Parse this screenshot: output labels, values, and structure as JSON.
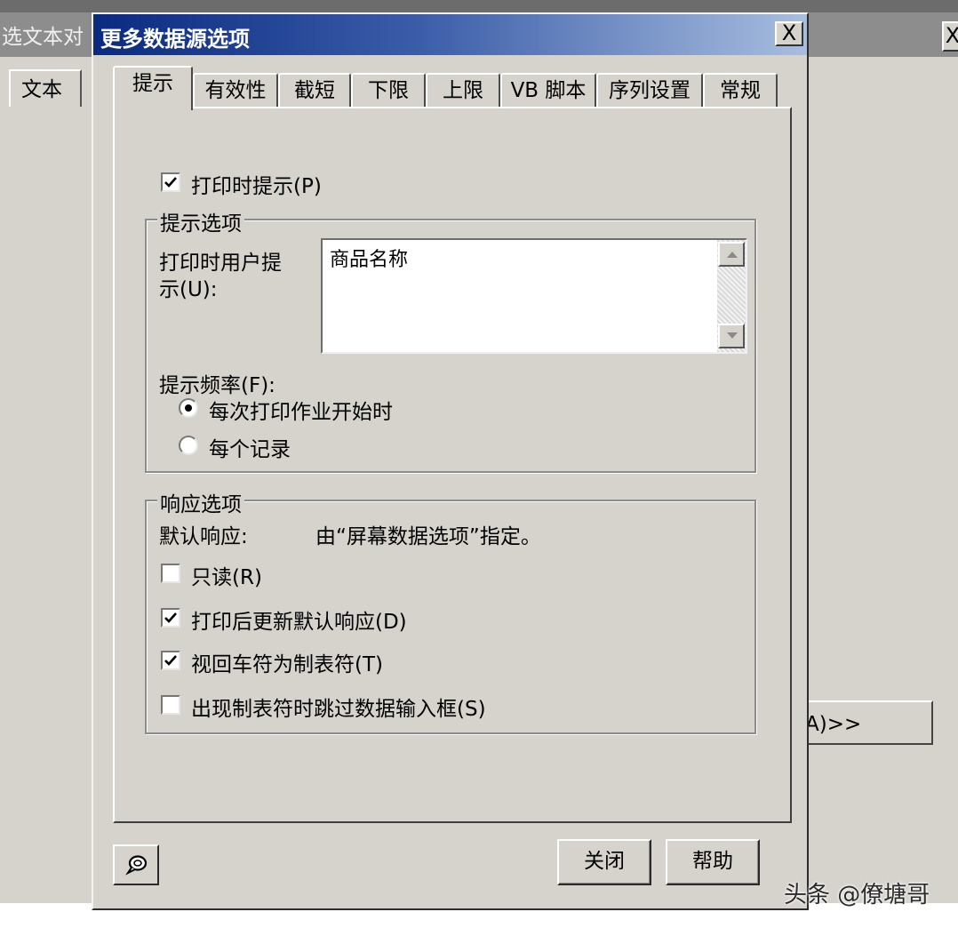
{
  "background_window": {
    "title": "选文本对",
    "close_label": "X",
    "tab_label": "文本",
    "button_label": "A)>>"
  },
  "dialog": {
    "title": "更多数据源选项",
    "close_label": "X",
    "tabs": [
      {
        "label": "提示",
        "active": true
      },
      {
        "label": "有效性",
        "active": false
      },
      {
        "label": "截短",
        "active": false
      },
      {
        "label": "下限",
        "active": false
      },
      {
        "label": "上限",
        "active": false
      },
      {
        "label": "VB 脚本",
        "active": false
      },
      {
        "label": "序列设置",
        "active": false
      },
      {
        "label": "常规",
        "active": false
      }
    ]
  },
  "prompt_tab": {
    "prompt_on_print": {
      "label": "打印时提示(P)",
      "checked": true
    },
    "prompt_options": {
      "title": "提示选项",
      "user_prompt_label_line1": "打印时用户提",
      "user_prompt_label_line2": "示(U):",
      "user_prompt_value": "商品名称",
      "frequency_label": "提示频率(F):",
      "frequency_options": [
        {
          "label": "每次打印作业开始时",
          "selected": true
        },
        {
          "label": "每个记录",
          "selected": false
        }
      ]
    },
    "response_options": {
      "title": "响应选项",
      "default_response_label": "默认响应:",
      "default_response_value": "由“屏幕数据选项”指定。",
      "checkboxes": [
        {
          "label": "只读(R)",
          "checked": false
        },
        {
          "label": "打印后更新默认响应(D)",
          "checked": true
        },
        {
          "label": "视回车符为制表符(T)",
          "checked": true
        },
        {
          "label": "出现制表符时跳过数据输入框(S)",
          "checked": false
        }
      ]
    }
  },
  "footer": {
    "close_button": "关闭",
    "help_button": "帮助",
    "help_icon": "help-bubble-icon"
  },
  "watermark": "头条 @僚塘哥",
  "colors": {
    "dialog_bg": "#d6d2cc",
    "titlebar_start": "#0a2a80",
    "titlebar_end": "#a8bedf"
  }
}
